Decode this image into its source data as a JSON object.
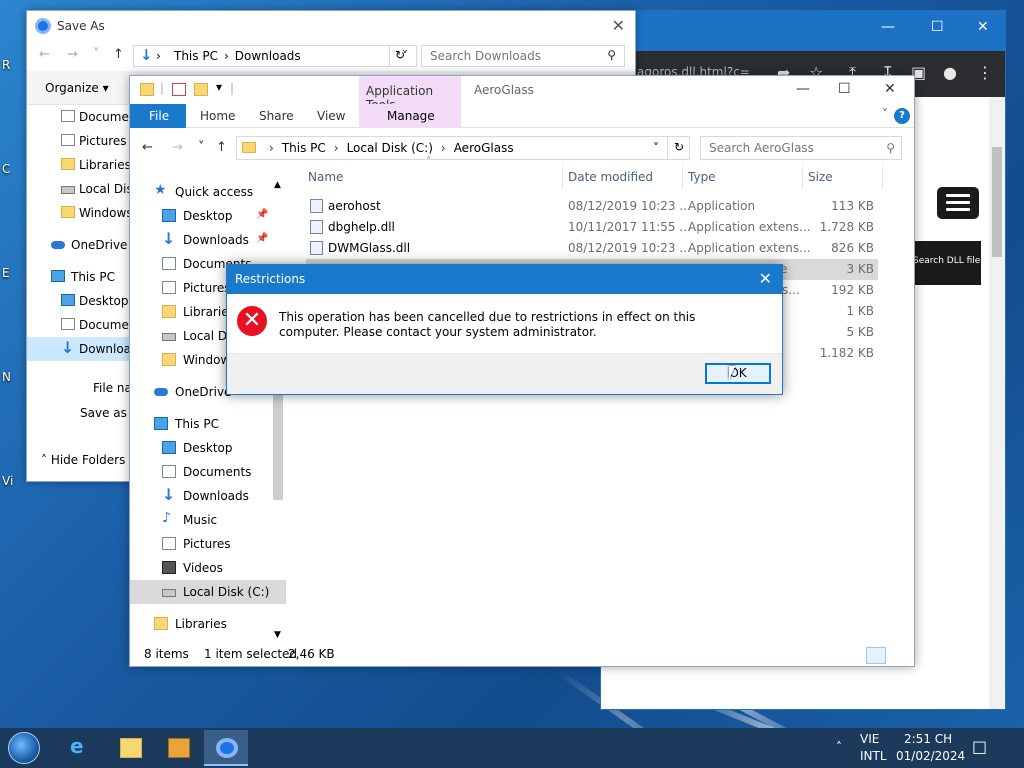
{
  "desktop": {
    "labels": [
      "R",
      "C",
      "E",
      "N",
      "Vi"
    ]
  },
  "chrome": {
    "tab_fragment": "agoros.dll.html?c=",
    "search_dll_label": "Search DLL file"
  },
  "saveas": {
    "title": "Save As",
    "path": [
      "This PC",
      "Downloads"
    ],
    "search_placeholder": "Search Downloads",
    "organize": "Organize",
    "sidebar": [
      "Documents",
      "Pictures",
      "Libraries",
      "Local Disk",
      "Windows",
      "OneDrive",
      "This PC",
      "Desktop",
      "Documents",
      "Downloads"
    ],
    "file_name_label": "File name:",
    "save_type_label": "Save as type:",
    "hide_folders": "Hide Folders"
  },
  "explorer": {
    "app_tools": "Application Tools",
    "window_title": "AeroGlass",
    "tabs": [
      "File",
      "Home",
      "Share",
      "View",
      "Manage"
    ],
    "path": [
      "This PC",
      "Local Disk (C:)",
      "AeroGlass"
    ],
    "search_placeholder": "Search AeroGlass",
    "sidebar": [
      {
        "label": "Quick access",
        "top": true
      },
      {
        "label": "Desktop",
        "pin": true
      },
      {
        "label": "Downloads",
        "pin": true
      },
      {
        "label": "Documents",
        "pin": true
      },
      {
        "label": "Pictures",
        "pin": true
      },
      {
        "label": "Libraries"
      },
      {
        "label": "Local Disk"
      },
      {
        "label": "Windows"
      },
      {
        "label": "OneDrive",
        "top": true
      },
      {
        "label": "This PC",
        "top": true
      },
      {
        "label": "Desktop"
      },
      {
        "label": "Documents"
      },
      {
        "label": "Downloads"
      },
      {
        "label": "Music"
      },
      {
        "label": "Pictures"
      },
      {
        "label": "Videos"
      },
      {
        "label": "Local Disk (C:)",
        "selected": true
      },
      {
        "label": "Libraries",
        "top": true
      }
    ],
    "columns": [
      "Name",
      "Date modified",
      "Type",
      "Size"
    ],
    "files": [
      {
        "name": "aerohost",
        "date": "08/12/2019 10:23 ...",
        "type": "Application",
        "size": "113 KB"
      },
      {
        "name": "dbghelp.dll",
        "date": "10/11/2017 11:55 ...",
        "type": "Application extens...",
        "size": "1.728 KB"
      },
      {
        "name": "DWMGlass.dll",
        "date": "08/12/2019 10:23 ...",
        "type": "Application extens...",
        "size": "826 KB"
      },
      {
        "name": "",
        "date": "",
        "type": "e",
        "size": "3 KB",
        "selected": true
      },
      {
        "name": "",
        "date": "",
        "type": "s...",
        "size": "192 KB"
      },
      {
        "name": "",
        "date": "",
        "type": "",
        "size": "1 KB"
      },
      {
        "name": "",
        "date": "",
        "type": "",
        "size": "5 KB"
      },
      {
        "name": "",
        "date": "",
        "type": "",
        "size": "1.182 KB"
      }
    ],
    "status_items": "8 items",
    "status_selected": "1 item selected",
    "status_size": "2,46 KB"
  },
  "dialog": {
    "title": "Restrictions",
    "message": "This operation has been cancelled due to restrictions in effect on this computer. Please contact your system administrator.",
    "ok_label": "OK"
  },
  "taskbar": {
    "day": "VIE",
    "lang": "INTL",
    "time": "2:51 CH",
    "date": "01/02/2024"
  }
}
